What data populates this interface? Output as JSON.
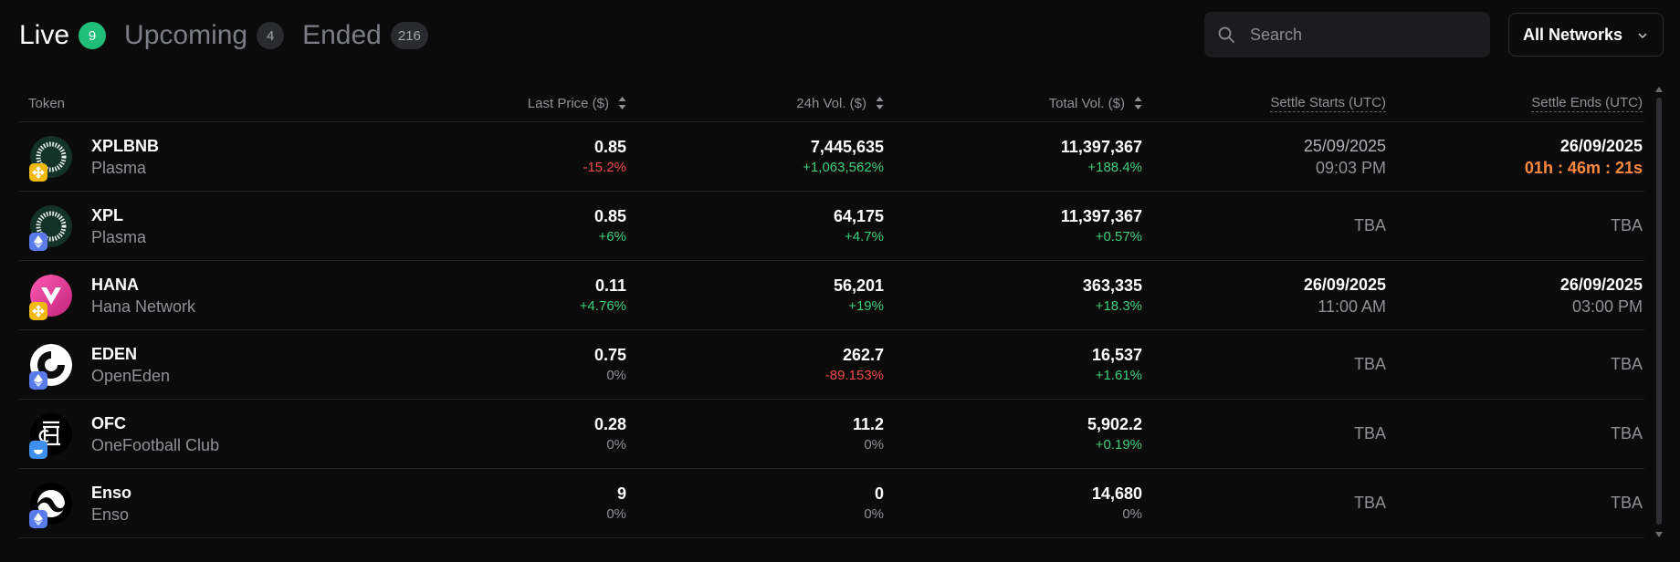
{
  "tabs": [
    {
      "label": "Live",
      "count": "9",
      "active": true
    },
    {
      "label": "Upcoming",
      "count": "4",
      "active": false
    },
    {
      "label": "Ended",
      "count": "216",
      "active": false
    }
  ],
  "search": {
    "placeholder": "Search",
    "icon": "search-icon"
  },
  "network_select": {
    "label": "All Networks",
    "icon": "chevron-down-icon"
  },
  "columns": {
    "token": "Token",
    "last_price": "Last Price ($)",
    "vol_24h": "24h Vol. ($)",
    "total_vol": "Total Vol. ($)",
    "settle_starts": "Settle Starts (UTC)",
    "settle_ends": "Settle Ends (UTC)"
  },
  "colors": {
    "positive": "#3ecf7d",
    "negative": "#f04a4a",
    "countdown": "#ff8a3d",
    "live_badge": "#1fbf7a"
  },
  "rows": [
    {
      "symbol": "XPLBNB",
      "name": "Plasma",
      "logo": "plasma-logo-icon",
      "chain": "bnb-chain-icon",
      "price": "0.85",
      "price_change": "-15.2%",
      "vol24": "7,445,635",
      "vol24_change": "+1,063,562%",
      "total": "11,397,367",
      "total_change": "+188.4%",
      "start_date": "25/09/2025",
      "start_time": "09:03 PM",
      "end_date": "26/09/2025",
      "end_time": "01h : 46m : 21s"
    },
    {
      "symbol": "XPL",
      "name": "Plasma",
      "logo": "plasma-logo-icon",
      "chain": "ethereum-icon",
      "price": "0.85",
      "price_change": "+6%",
      "vol24": "64,175",
      "vol24_change": "+4.7%",
      "total": "11,397,367",
      "total_change": "+0.57%",
      "start": "TBA",
      "end": "TBA"
    },
    {
      "symbol": "HANA",
      "name": "Hana Network",
      "logo": "hana-logo-icon",
      "chain": "bnb-chain-icon",
      "price": "0.11",
      "price_change": "+4.76%",
      "vol24": "56,201",
      "vol24_change": "+19%",
      "total": "363,335",
      "total_change": "+18.3%",
      "start_date": "26/09/2025",
      "start_time": "11:00 AM",
      "end_date": "26/09/2025",
      "end_time": "03:00 PM"
    },
    {
      "symbol": "EDEN",
      "name": "OpenEden",
      "logo": "openeden-logo-icon",
      "chain": "ethereum-icon",
      "price": "0.75",
      "price_change": "0%",
      "vol24": "262.7",
      "vol24_change": "-89.153%",
      "total": "16,537",
      "total_change": "+1.61%",
      "start": "TBA",
      "end": "TBA"
    },
    {
      "symbol": "OFC",
      "name": "OneFootball Club",
      "logo": "onefootball-logo-icon",
      "chain": "ton-icon",
      "price": "0.28",
      "price_change": "0%",
      "vol24": "11.2",
      "vol24_change": "0%",
      "total": "5,902.2",
      "total_change": "+0.19%",
      "start": "TBA",
      "end": "TBA"
    },
    {
      "symbol": "Enso",
      "name": "Enso",
      "logo": "enso-logo-icon",
      "chain": "ethereum-icon",
      "price": "9",
      "price_change": "0%",
      "vol24": "0",
      "vol24_change": "0%",
      "total": "14,680",
      "total_change": "0%",
      "start": "TBA",
      "end": "TBA"
    }
  ]
}
